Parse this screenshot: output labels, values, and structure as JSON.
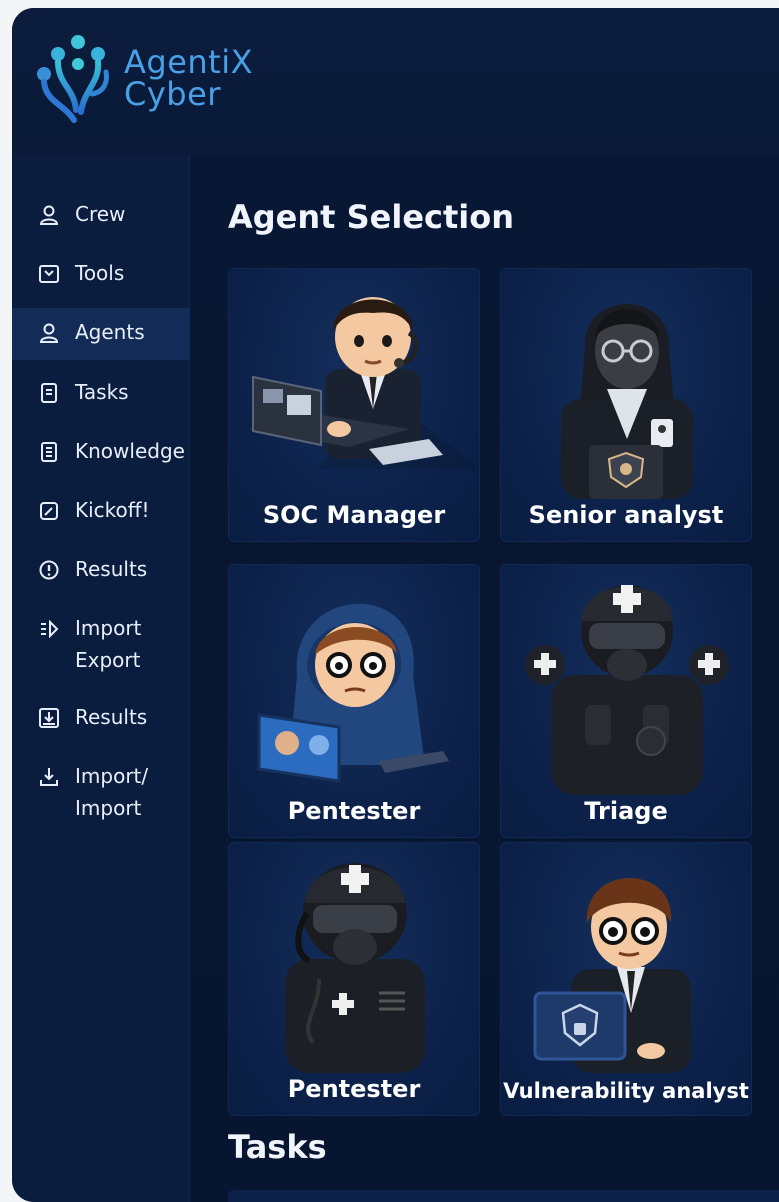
{
  "app": {
    "brand_line1": "AgentiX",
    "brand_line2": "Cyber",
    "accent": "#4aa0e6",
    "background": "#091833"
  },
  "sidebar": {
    "items": [
      {
        "label": "Crew",
        "icon": "user-icon"
      },
      {
        "label": "Tools",
        "icon": "tools-icon"
      },
      {
        "label": "Agents",
        "icon": "user-icon",
        "active": true
      },
      {
        "label": "Tasks",
        "icon": "document-icon"
      },
      {
        "label": "Knowledge",
        "icon": "document-lines-icon"
      },
      {
        "label": "Kickoff!",
        "icon": "edit-icon"
      },
      {
        "label": "Results",
        "icon": "info-circle-icon"
      },
      {
        "label_line1": "Import",
        "label_line2": "Export",
        "icon": "import-export-icon"
      },
      {
        "label": "Results",
        "icon": "download-box-icon"
      },
      {
        "label_line1": "Import/",
        "label_line2": "Import",
        "icon": "download-icon"
      }
    ]
  },
  "main": {
    "section_title": "Agent Selection",
    "agents": [
      {
        "name": "SOC Manager",
        "avatar": "soc-manager-avatar"
      },
      {
        "name": "Senior analyst",
        "avatar": "senior-analyst-avatar"
      },
      {
        "name": "Pentester",
        "avatar": "hooded-pentester-avatar"
      },
      {
        "name": "Triage",
        "avatar": "triage-medic-avatar"
      },
      {
        "name": "Pentester",
        "avatar": "helmet-pentester-avatar"
      },
      {
        "name": "Vulnerability analyst",
        "avatar": "vulnerability-analyst-avatar"
      }
    ],
    "tasks_title": "Tasks"
  }
}
